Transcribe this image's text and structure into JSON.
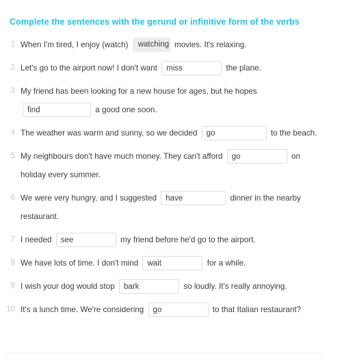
{
  "exercise": {
    "title": "Complete the sentences with the gerund or infinitive form of the verbs",
    "title_color": "#1fc3e8",
    "questions": [
      {
        "number": "1",
        "before": "When I'm tired, I enjoy (watch)",
        "answer": "watching",
        "answer_state": "filled",
        "after": "movies. It's relaxing."
      },
      {
        "number": "2",
        "before": "Let's go to the airport now! I don't want",
        "answer": "miss",
        "answer_state": "input",
        "after": "the plane."
      },
      {
        "number": "3",
        "before": "My friend has been looking for a new house for ages, but he hopes",
        "answer": "find",
        "answer_state": "input",
        "after": "a good one soon."
      },
      {
        "number": "4",
        "before": "The weather was warm and sunny, so we decided",
        "answer": "go",
        "answer_state": "input",
        "after": "to the beach."
      },
      {
        "number": "5",
        "before": "My neighbours don't have much money. They can't afford",
        "answer": "go",
        "answer_state": "input",
        "after": "on holiday every summer."
      },
      {
        "number": "6",
        "before": "We were very hungry, and I suggested",
        "answer": "have",
        "answer_state": "input",
        "after": "dinner in the nearby restaurant."
      },
      {
        "number": "7",
        "before": "I needed",
        "answer": "see",
        "answer_state": "input",
        "after": "my friend before he'd go to the airport."
      },
      {
        "number": "8",
        "before": "We have lots of time. I don't mind",
        "answer": "wait",
        "answer_state": "input",
        "after": "for a while."
      },
      {
        "number": "9",
        "before": "I wish your dog would stop",
        "answer": "bark",
        "answer_state": "input",
        "after": "so loudly. It's really annoying."
      },
      {
        "number": "10",
        "before": "It's a lunch time. We're considering",
        "answer": "go",
        "answer_state": "input",
        "after": "to that Italian restaurant?"
      }
    ]
  }
}
